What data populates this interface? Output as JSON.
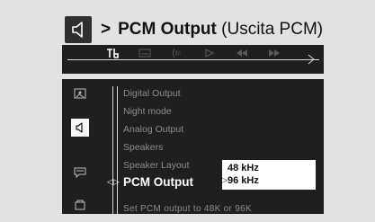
{
  "header": {
    "arrow": ">",
    "title": "PCM Output",
    "subtitle": "(Uscita PCM)",
    "icon": "speaker-icon"
  },
  "topbar": {
    "icons": [
      "settings-icon",
      "subtitle-icon",
      "audio-icon",
      "play-icon",
      "rewind-icon",
      "fast-forward-icon"
    ],
    "selected": "settings-icon"
  },
  "sidebar": {
    "icons": [
      "picture-icon",
      "speaker-icon",
      "chat-icon",
      "lock-icon"
    ],
    "selected": "speaker-icon"
  },
  "menu": {
    "items": [
      {
        "label": "Digital Output"
      },
      {
        "label": "Night mode"
      },
      {
        "label": "Analog Output"
      },
      {
        "label": "Speakers"
      },
      {
        "label": "Speaker Layout"
      },
      {
        "label": "PCM Output"
      }
    ],
    "active_index": 5
  },
  "popup": {
    "options": [
      "48 kHz",
      "96 kHz"
    ],
    "selected": "96 kHz"
  },
  "hint": "Set PCM output to 48K or 96K"
}
